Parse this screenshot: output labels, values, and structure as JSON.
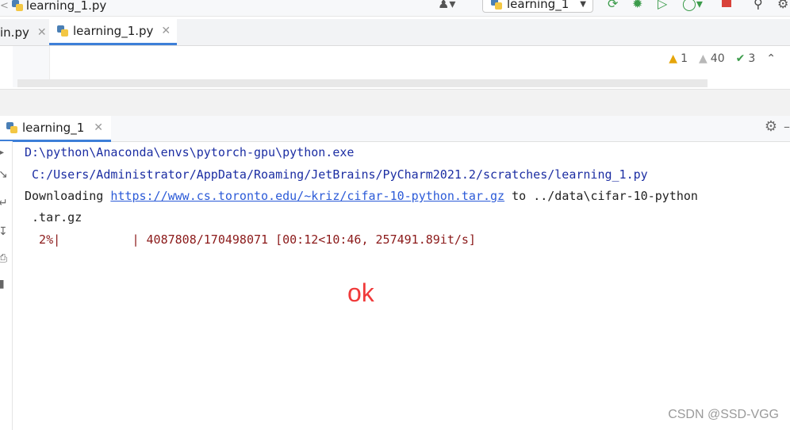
{
  "nav": {
    "breadcrumb_file": "learning_1.py",
    "run_config": "learning_1"
  },
  "editor_tabs": [
    {
      "label": "in.py"
    },
    {
      "label": "learning_1.py"
    }
  ],
  "inspections": {
    "warnings": "1",
    "weak_warnings": "40",
    "typos": "3"
  },
  "run_window": {
    "tab_label": "learning_1"
  },
  "console": {
    "line1": "D:\\python\\Anaconda\\envs\\pytorch-gpu\\python.exe",
    "line2": " C:/Users/Administrator/AppData/Roaming/JetBrains/PyCharm2021.2/scratches/learning_1.py",
    "line3_prefix": "Downloading ",
    "line3_link": "https://www.cs.toronto.edu/~kriz/cifar-10-python.tar.gz",
    "line3_suffix": " to ../data\\cifar-10-python",
    "line4": " .tar.gz",
    "line5_pct": "  2%|",
    "line5_rest": "          | 4087808/170498071 [00:12<10:46, 257491.89it/s]"
  },
  "annotation": "ok",
  "watermark": "CSDN @SSD-VGG",
  "colors": {
    "accent": "#3d7fd8",
    "progress_red": "#8b1a1a",
    "path_blue": "#1c2ea3",
    "annotation_red": "#f03a3a"
  }
}
